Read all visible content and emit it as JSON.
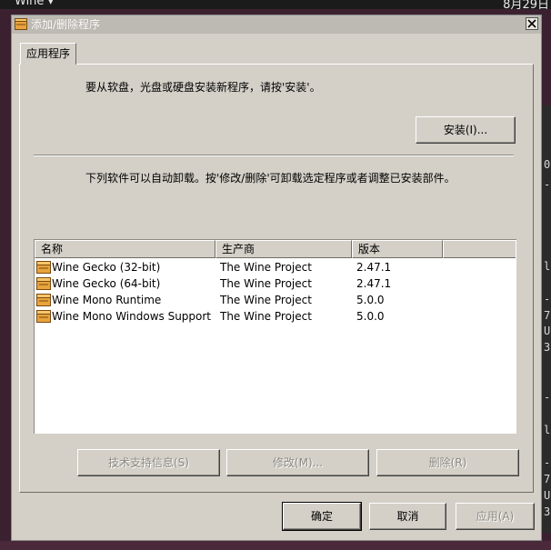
{
  "desktop": {
    "topbar_app": "Wine ▾",
    "topbar_date": "8月29日",
    "terminal_lines": [
      "0",
      "-",
      "l",
      "-",
      "7",
      "U",
      "3",
      "-",
      "l",
      "-",
      "7",
      "U",
      "3"
    ]
  },
  "window": {
    "title": "添加/删除程序",
    "tab_label": "应用程序",
    "install_instruction": "要从软盘，光盘或硬盘安装新程序，请按'安装'。",
    "install_button": "安装(I)...",
    "uninstall_instruction": "下列软件可以自动卸载。按'修改/删除'可卸载选定程序或者调整已安装部件。",
    "list": {
      "columns": [
        "名称",
        "生产商",
        "版本"
      ],
      "rows": [
        {
          "name": "Wine Gecko (32-bit)",
          "publisher": "The Wine Project",
          "version": "2.47.1"
        },
        {
          "name": "Wine Gecko (64-bit)",
          "publisher": "The Wine Project",
          "version": "2.47.1"
        },
        {
          "name": "Wine Mono Runtime",
          "publisher": "The Wine Project",
          "version": "5.0.0"
        },
        {
          "name": "Wine Mono Windows Support",
          "publisher": "The Wine Project",
          "version": "5.0.0"
        }
      ]
    },
    "support_button": "技术支持信息(S)",
    "modify_button": "修改(M)...",
    "remove_button": "删除(R)",
    "ok_button": "确定",
    "cancel_button": "取消",
    "apply_button": "应用(A)",
    "icon": "installer-box-icon",
    "close_icon": "close-icon"
  }
}
